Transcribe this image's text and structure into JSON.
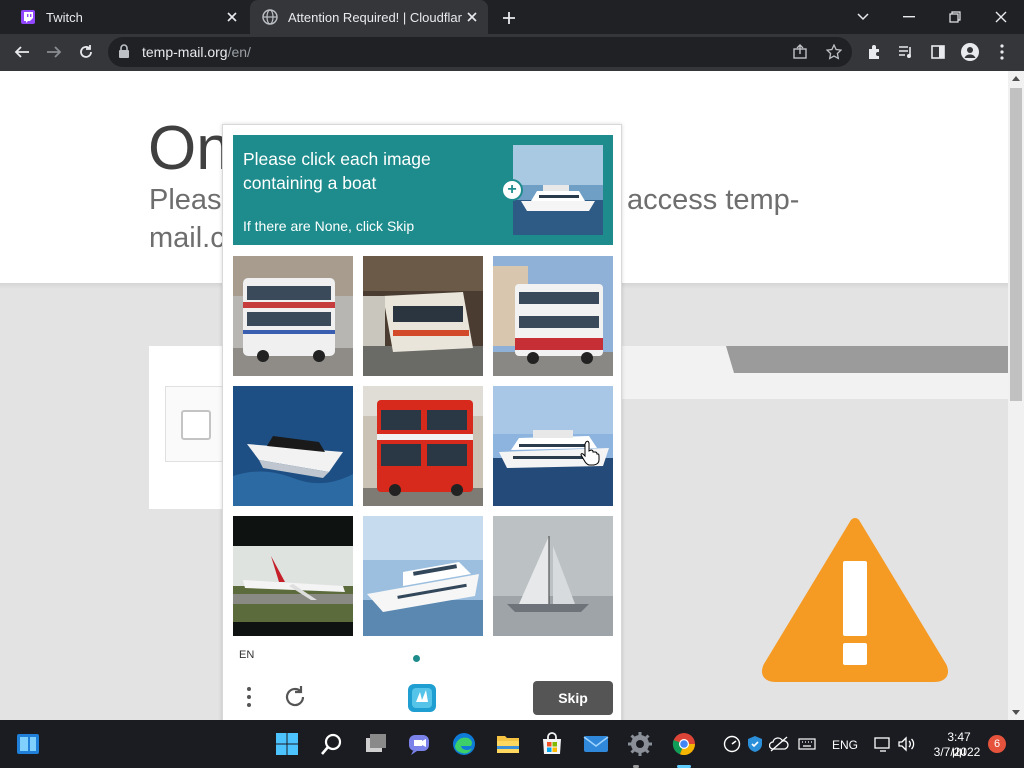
{
  "browser": {
    "tabs": [
      {
        "title": "Twitch",
        "active": false,
        "favicon": "twitch-icon"
      },
      {
        "title": "Attention Required! | Cloudflare",
        "active": true,
        "favicon": "globe-icon"
      }
    ],
    "url_host": "temp-mail.org",
    "url_path": "/en/",
    "accent_colors": {
      "tabstrip": "#202124",
      "toolbar": "#35363a"
    }
  },
  "page": {
    "heading": "One",
    "subtitle": "Please                                                           access temp-mail.c",
    "subtitle_left": "Please",
    "subtitle_right": "access temp-",
    "subtitle_line2": "mail.c",
    "warning_color": "#f59a23"
  },
  "captcha": {
    "prompt": "Please click each image containing a boat",
    "hint": "If there are None, click Skip",
    "language": "EN",
    "skip_label": "Skip",
    "theme_color": "#1e8c8c",
    "tiles": [
      {
        "subject": "double-decker bus"
      },
      {
        "subject": "train"
      },
      {
        "subject": "double-decker bus"
      },
      {
        "subject": "speedboat"
      },
      {
        "subject": "red double-decker bus"
      },
      {
        "subject": "yacht"
      },
      {
        "subject": "airplane"
      },
      {
        "subject": "motor yacht"
      },
      {
        "subject": "sailboat"
      }
    ]
  },
  "taskbar": {
    "language": "ENG",
    "time": "3:47 μμ",
    "date": "3/7/2022",
    "notifications": "6",
    "apps": [
      "start-icon",
      "search-icon",
      "task-view-icon",
      "teams-chat-icon",
      "edge-icon",
      "file-explorer-icon",
      "microsoft-store-icon",
      "mail-icon",
      "settings-icon",
      "chrome-icon"
    ]
  }
}
